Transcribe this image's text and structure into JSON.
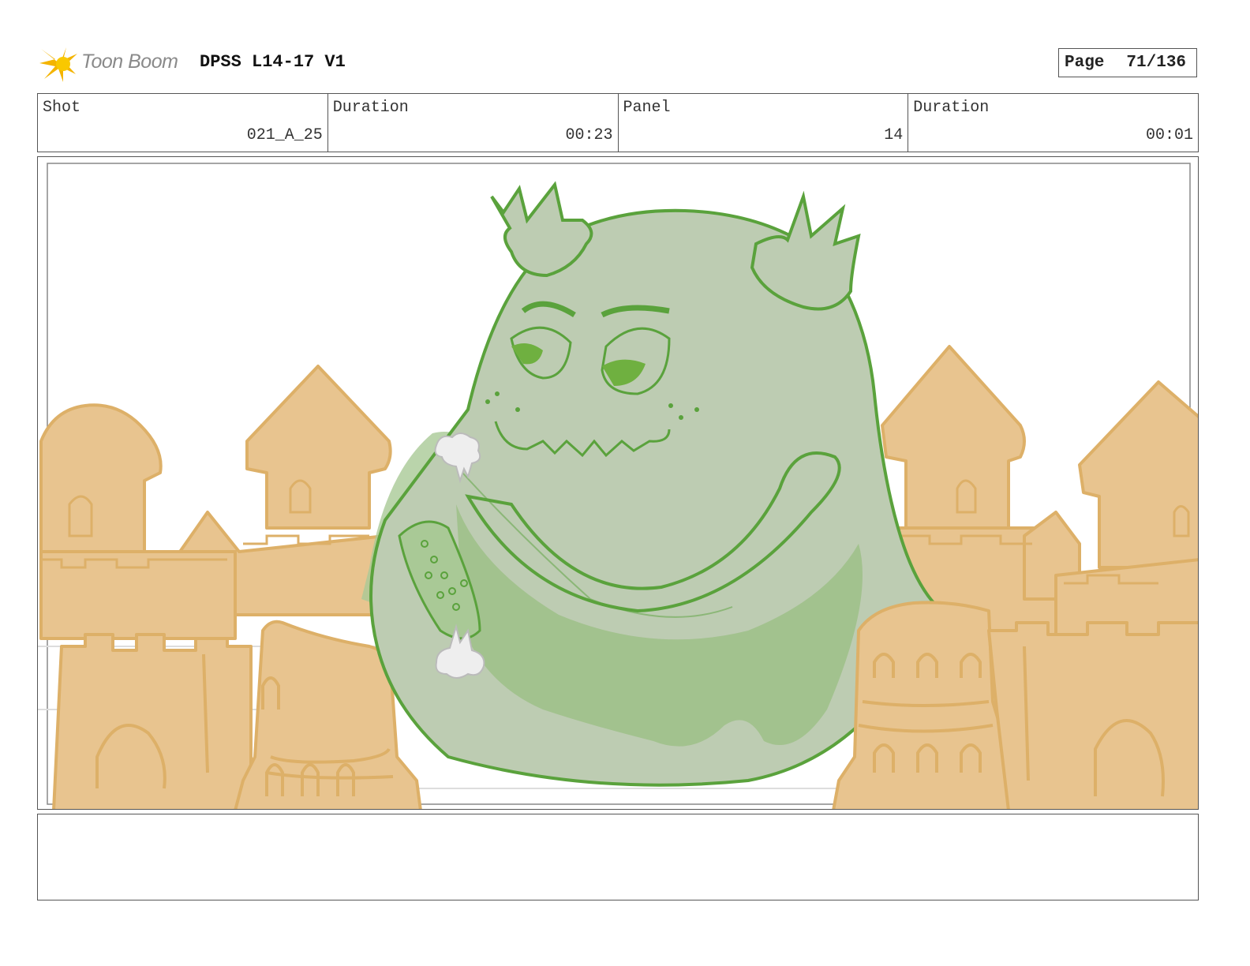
{
  "header": {
    "logo_text": "Toon Boom",
    "title": "DPSS L14-17 V1",
    "page_label": "Page",
    "page_number": "71/136"
  },
  "info": {
    "shot_label": "Shot",
    "shot_value": "021_A_25",
    "shot_duration_label": "Duration",
    "shot_duration_value": "00:23",
    "panel_label": "Panel",
    "panel_value": "14",
    "panel_duration_label": "Duration",
    "panel_duration_value": "00:01"
  },
  "panel": {
    "image": "storyboard-sketch",
    "colors": {
      "sand": "#e8c48f",
      "sand_line": "#ddb068",
      "monster_fill": "#bdccb2",
      "monster_line": "#5aa23c",
      "monster_shade": "#9dc087"
    }
  },
  "notes": {
    "text": ""
  }
}
